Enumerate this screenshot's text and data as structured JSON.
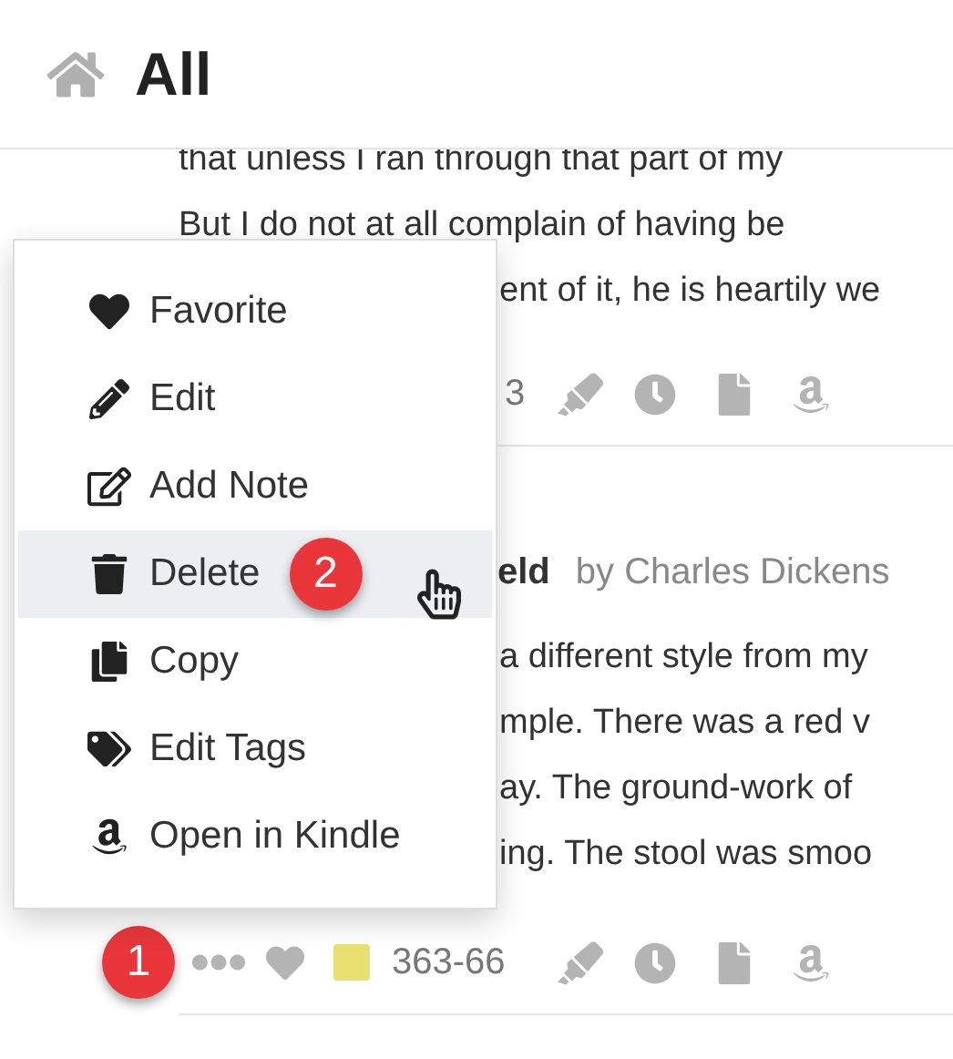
{
  "header": {
    "title": "All"
  },
  "cards": [
    {
      "lines": [
        "that unless I ran through that part of my",
        "But I do not at all complain of having be"
      ],
      "cut_lines": [
        "ent of it, he is heartily we"
      ],
      "footer": {
        "page": "3"
      }
    },
    {
      "title": "eld",
      "author": "by Charles Dickens",
      "cut_lines": [
        "a different style from my",
        "mple. There was a red v",
        "ay. The ground-work of",
        "ing. The stool was smoo"
      ],
      "footer": {
        "badge": "1",
        "color": "#e8e070",
        "page": "363-66"
      }
    }
  ],
  "menu": {
    "items": [
      {
        "label": "Favorite",
        "selected": false
      },
      {
        "label": "Edit",
        "selected": false
      },
      {
        "label": "Add Note",
        "selected": false
      },
      {
        "label": "Delete",
        "selected": true,
        "badge": "2"
      },
      {
        "label": "Copy",
        "selected": false
      },
      {
        "label": "Edit Tags",
        "selected": false
      },
      {
        "label": "Open in Kindle",
        "selected": false
      }
    ]
  }
}
